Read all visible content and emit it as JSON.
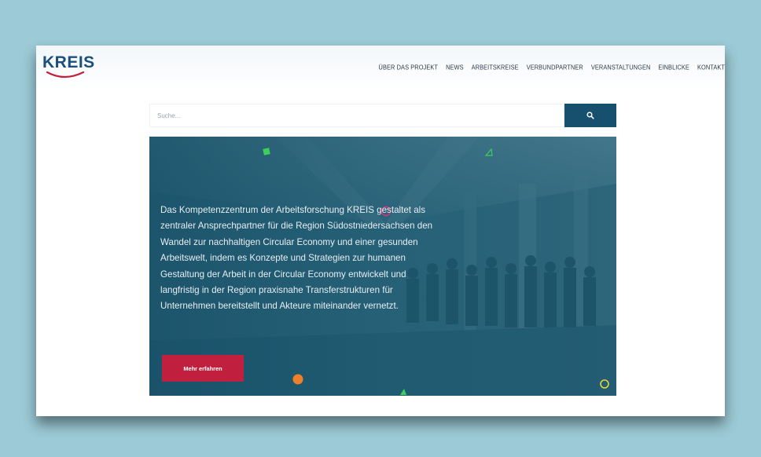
{
  "brand": {
    "logo_text": "KREIS",
    "colors": {
      "primary": "#1b4f7c",
      "accent_red": "#c0203d",
      "button_blue": "#17506e"
    }
  },
  "nav": {
    "items": [
      "ÜBER DAS PROJEKT",
      "NEWS",
      "ARBEITSKREISE",
      "VERBUNDPARTNER",
      "VERANSTALTUNGEN",
      "EINBLICKE",
      "KONTAKT"
    ]
  },
  "search": {
    "placeholder": "Suche...",
    "value": "",
    "button_icon": "search-icon"
  },
  "hero": {
    "text": "Das Kompetenzzentrum der Arbeitsforschung KREIS gestaltet als zentraler Ansprechpartner für die Region Südostniedersachsen den Wandel zur nachhaltigen Circular Economy und einer gesunden Arbeitswelt, indem es Konzepte und Strategien zur humanen Gestaltung der Arbeit in der Circular Economy entwickelt und langfristig in der Region praxisnahe Transferstrukturen für Unternehmen bereitstellt und Akteure miteinander vernetzt.",
    "cta_label": "Mehr erfahren",
    "decoration_colors": {
      "green": "#3ccf5a",
      "orange": "#f07f2a",
      "magenta": "#e0307a",
      "yellow": "#e8d23a"
    }
  }
}
